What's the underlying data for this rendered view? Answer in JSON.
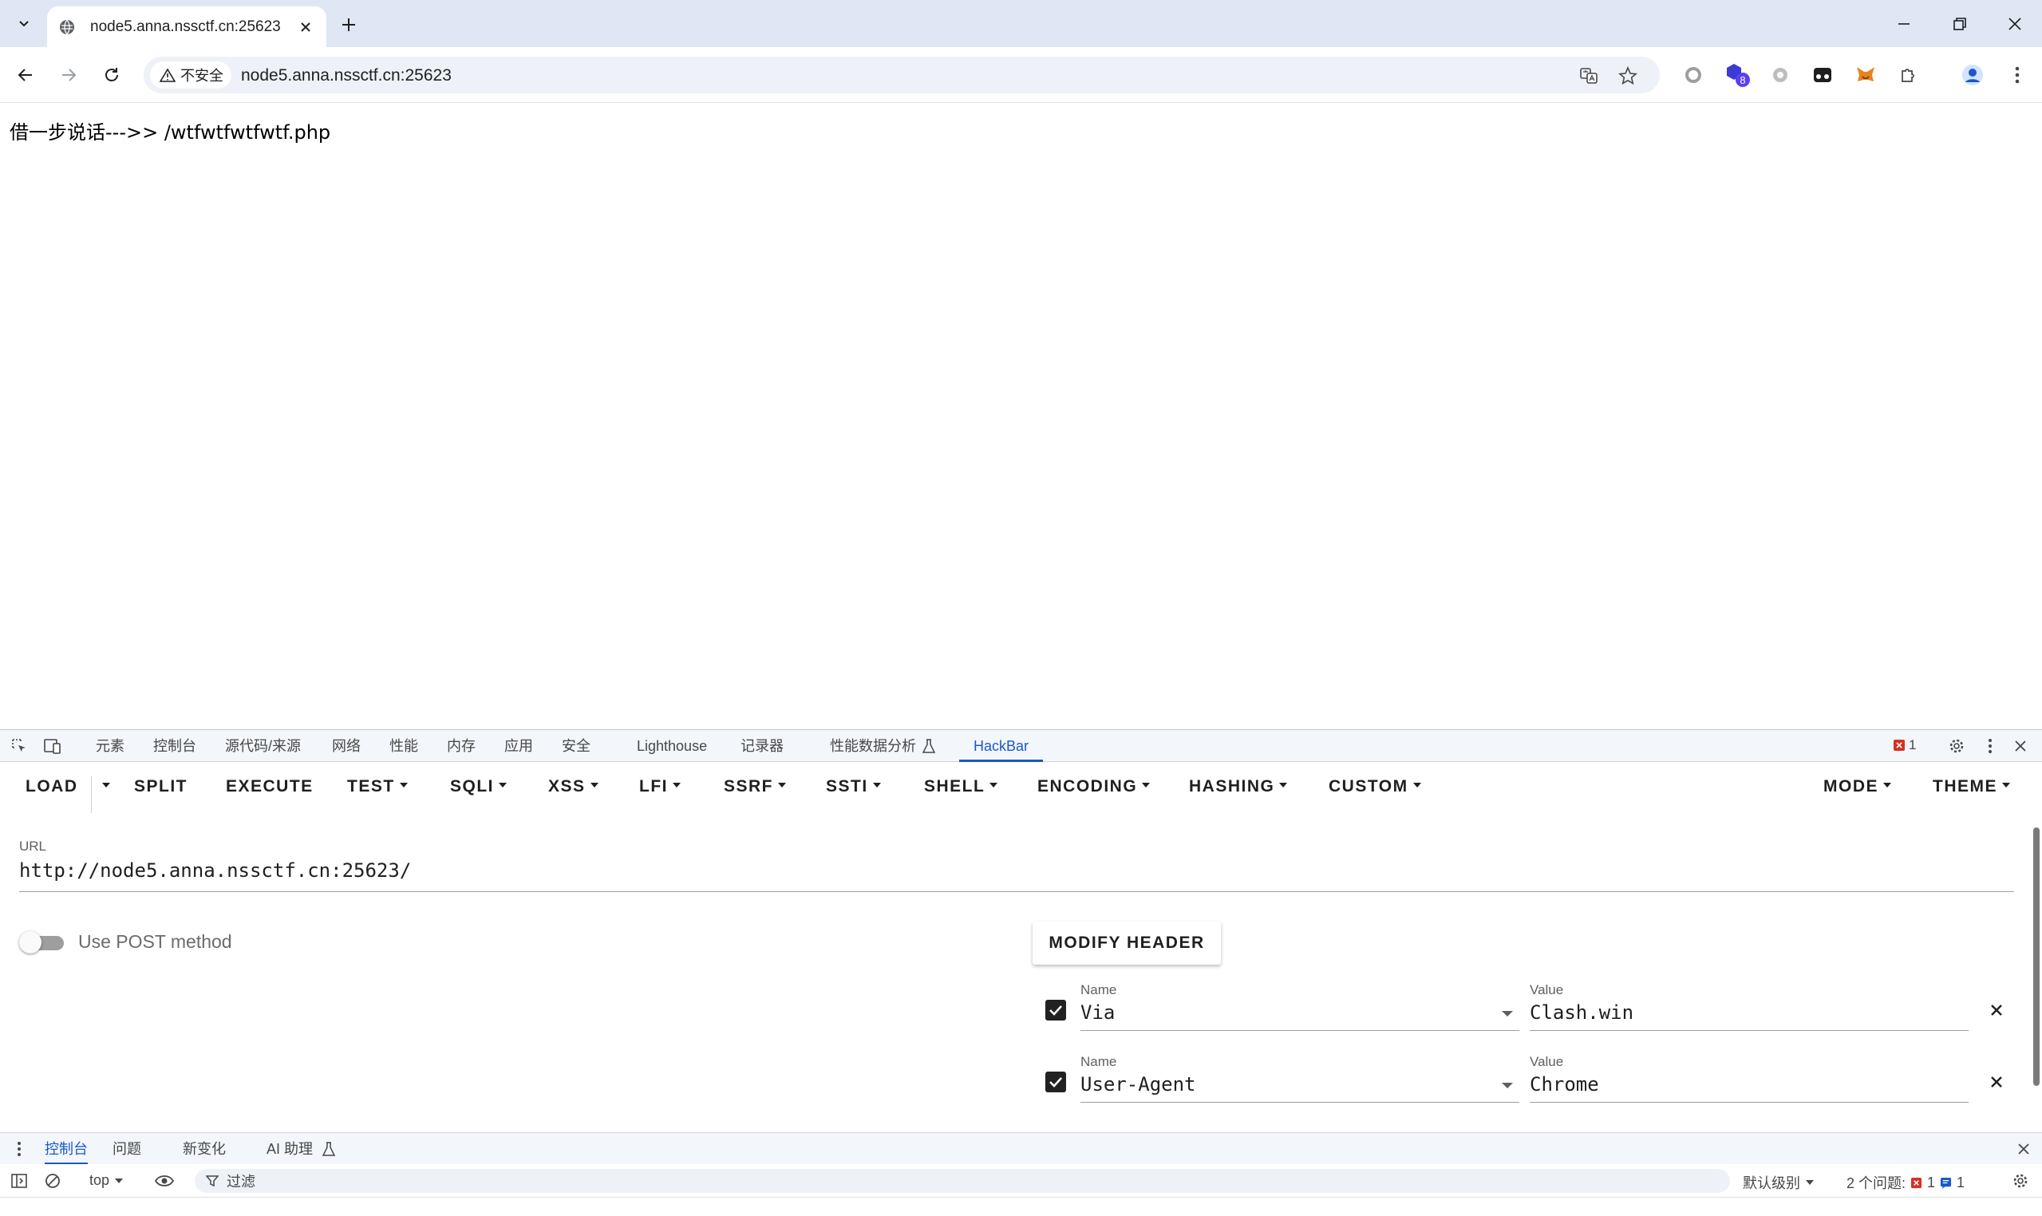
{
  "browser": {
    "tab_title": "node5.anna.nssctf.cn:25623",
    "security_label": "不安全",
    "address": "node5.anna.nssctf.cn:25623",
    "extension_badge": "8"
  },
  "page": {
    "content_text": "借一步说话--->> /wtfwtfwtfwtf.php"
  },
  "devtools": {
    "tabs": [
      "元素",
      "控制台",
      "源代码/来源",
      "网络",
      "性能",
      "内存",
      "应用",
      "安全",
      "Lighthouse",
      "记录器",
      "性能数据分析",
      "HackBar"
    ],
    "active_tab": "HackBar",
    "error_count": "1"
  },
  "hackbar": {
    "buttons": [
      "LOAD",
      "SPLIT",
      "EXECUTE",
      "TEST",
      "SQLI",
      "XSS",
      "LFI",
      "SSRF",
      "SSTI",
      "SHELL",
      "ENCODING",
      "HASHING",
      "CUSTOM",
      "MODE",
      "THEME"
    ],
    "url_label": "URL",
    "url_value": "http://node5.anna.nssctf.cn:25623/",
    "post_label": "Use POST method",
    "post_enabled": false,
    "modify_header_label": "MODIFY HEADER",
    "name_label": "Name",
    "value_label": "Value",
    "headers": [
      {
        "enabled": true,
        "name": "Via",
        "value": "Clash.win"
      },
      {
        "enabled": true,
        "name": "User-Agent",
        "value": "Chrome"
      }
    ]
  },
  "drawer": {
    "tabs": [
      "控制台",
      "问题",
      "新变化",
      "AI 助理"
    ],
    "active_tab": "控制台",
    "context": "top",
    "filter_placeholder": "过滤",
    "level": "默认级别",
    "issues_label": "2 个问题:",
    "issues_errors": "1",
    "issues_info": "1"
  },
  "colors": {
    "accent": "#1a58c9",
    "tabstrip": "#dfe7f4",
    "error": "#d93025"
  }
}
